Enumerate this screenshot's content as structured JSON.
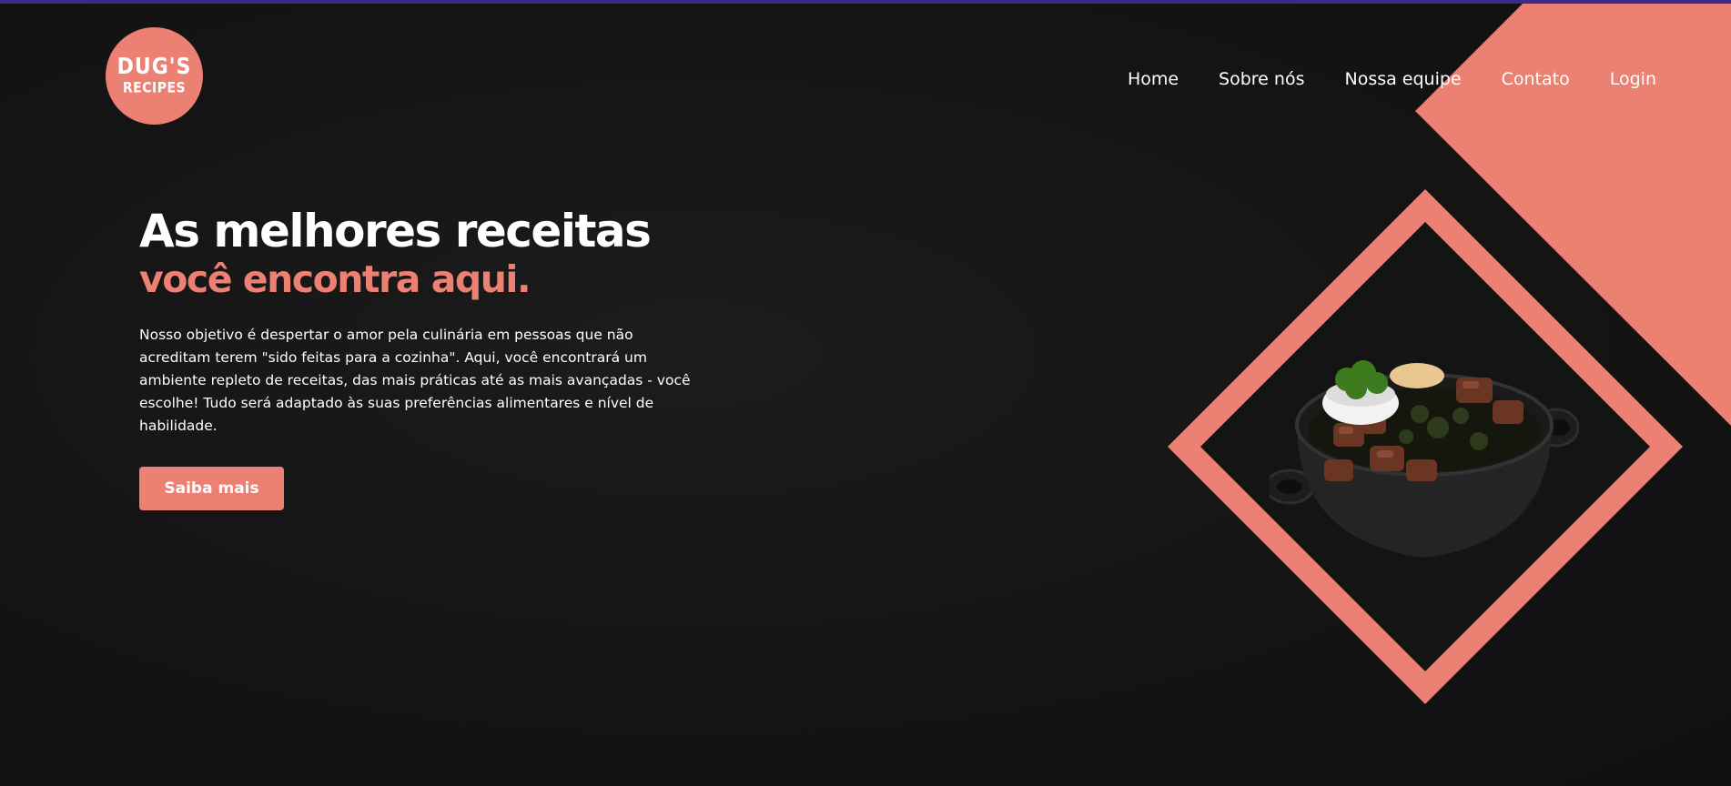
{
  "logo": {
    "line1": "DUG'S",
    "line2": "RECIPES"
  },
  "nav": {
    "items": [
      {
        "label": "Home"
      },
      {
        "label": "Sobre nós"
      },
      {
        "label": "Nossa equipe"
      },
      {
        "label": "Contato"
      },
      {
        "label": "Login"
      }
    ]
  },
  "hero": {
    "title": "As melhores receitas",
    "subtitle": "você encontra aqui.",
    "description": "Nosso objetivo é despertar o amor pela culinária em pessoas que não acreditam terem \"sido feitas para a cozinha\". Aqui, você encontrará um ambiente repleto de receitas, das mais práticas até as mais avançadas - você escolhe! Tudo será adaptado às suas preferências alimentares e nível de habilidade.",
    "cta_label": "Saiba mais"
  },
  "colors": {
    "accent": "#ec8072",
    "background": "#131313",
    "top_bar": "#3b2a8c"
  }
}
